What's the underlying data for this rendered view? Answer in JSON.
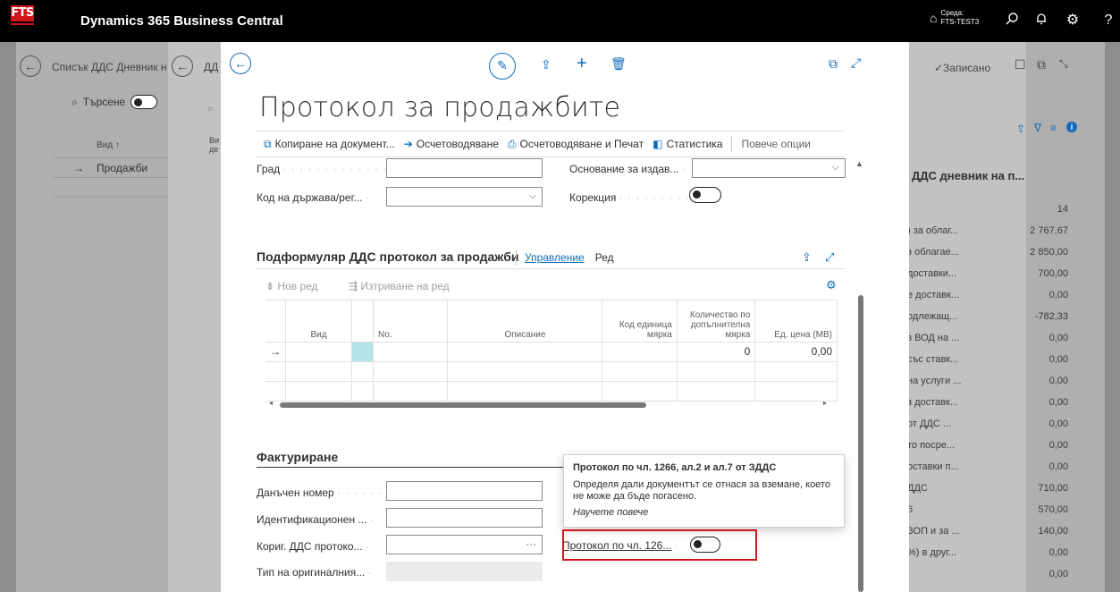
{
  "topbar": {
    "logo": "FTS",
    "app_name": "Dynamics 365 Business Central",
    "env_label": "Среда:",
    "env_value": "FTS-TEST3"
  },
  "background": {
    "list1_title": "Списък ДДС Дневник н",
    "list2_title": "ДД",
    "search_label": "Търсене",
    "col_vid": "Вид ↑",
    "col_vid2": "Ви де",
    "row_value": "Продажби",
    "saved_label": "✓Записано",
    "right_title": "ДДС дневник на п...",
    "right_rows": [
      {
        "label": "",
        "value": "14"
      },
      {
        "label": ") за облаг...",
        "value": "2 767,67"
      },
      {
        "label": "з облагае...",
        "value": "2 850,00"
      },
      {
        "label": "доставки...",
        "value": "700,00"
      },
      {
        "label": "е доставк...",
        "value": "0,00"
      },
      {
        "label": "одлежащ...",
        "value": "-782,33"
      },
      {
        "label": "з ВОД на ...",
        "value": "0,00"
      },
      {
        "label": "със ставк...",
        "value": "0,00"
      },
      {
        "label": "на услуги ...",
        "value": "0,00"
      },
      {
        "label": "з доставк...",
        "value": "0,00"
      },
      {
        "label": "от ДДС ...",
        "value": "0,00"
      },
      {
        "label": "то посре...",
        "value": "0,00"
      },
      {
        "label": "оставки п...",
        "value": "0,00"
      },
      {
        "label": "ДДС",
        "value": "710,00"
      },
      {
        "label": "6",
        "value": "570,00"
      },
      {
        "label": "ЗОП и за ...",
        "value": "140,00"
      },
      {
        "label": "%) в друг...",
        "value": "0,00"
      },
      {
        "label": "",
        "value": "0,00"
      }
    ]
  },
  "modal": {
    "title": "Протокол за продажбите",
    "actions": [
      "Копиране на документ...",
      "Осчетоводяване",
      "Осчетоводяване и Печат",
      "Статистика",
      "Повече опции"
    ],
    "fields": {
      "city": "Град",
      "country": "Код на държава/рег...",
      "basis": "Основание за издав...",
      "correction": "Корекция"
    },
    "subform": {
      "title": "Подформуляр ДДС протокол за продажби",
      "tab_manage": "Управление",
      "tab_line": "Ред",
      "new_line": "Нов ред",
      "delete_line": "Изтриване на ред",
      "columns": [
        "Вид",
        "No.",
        "Описание",
        "Код единица мярка",
        "Количество по допълнителна мярка",
        "Ед. цена (МВ)"
      ],
      "row_qty": "0",
      "row_price": "0,00"
    },
    "invoicing": {
      "title": "Фактуриране",
      "tax_number": "Данъчен номер",
      "identification": "Идентификационен ...",
      "corr_protocol": "Кориг. ДДС протоко...",
      "orig_type": "Тип на оригиналния...",
      "protocol_label": "Протокол по чл. 126..."
    },
    "tooltip": {
      "title": "Протокол по чл. 1266, ал.2 и ал.7 от ЗДДС",
      "body": "Определя дали документът се отнася за вземане, което не може да бъде погасено.",
      "link": "Научете повече"
    }
  }
}
